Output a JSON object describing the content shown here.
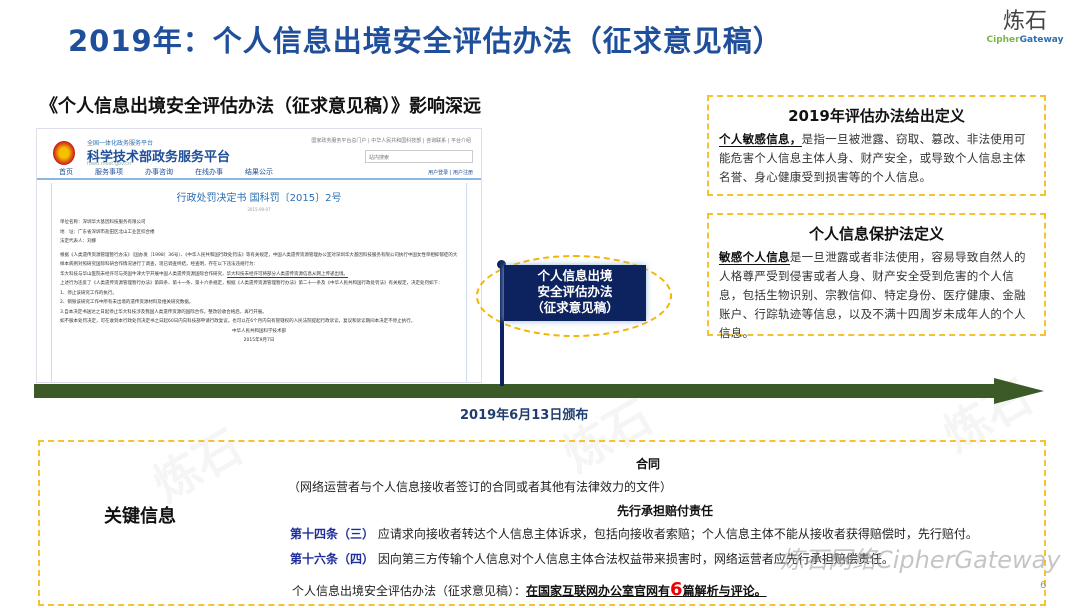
{
  "title": "2019年：个人信息出境安全评估办法（征求意见稿）",
  "logo": {
    "cn": "炼石",
    "en_a": "Cipher",
    "en_b": "Gateway"
  },
  "subtitle": "《个人信息出境安全评估办法（征求意见稿）》影响深远",
  "screenshot": {
    "site_top": "全国一体化政务服务平台",
    "site_name": "科学技术部政务服务平台",
    "site_url": "fuwu.most.gov.cn",
    "top_links": "国家政务服务平台总门户 | 中华人民共和国科技部 | 咨询联系 | 平台介绍",
    "search_placeholder": "站内搜索",
    "nav": [
      "首页",
      "服务事项",
      "办事咨询",
      "在线办事",
      "结果公示"
    ],
    "login": "用户登录 | 用户注册",
    "doc_title": "行政处罚决定书 国科罚〔2015〕2号",
    "doc_date": "2015-09-07",
    "lines": [
      "单位名称：深圳华大基因科技服务有限公司",
      "地　址：广东省深圳市盐田区北山工业区综合楼",
      "法定代表人：刘娜",
      "根据《人类遗传资源管理暂行办法》（国办发〔1998〕36号）、《中华人民共和国行政处罚法》等有关规定，中国人类遗传资源管理办公室对深圳华大基因科技服务有限公司执行中国女性单相抑郁症的大样本病例对照研究国际科研合作情况进行了调查，现已调查终结，经查明，存在以下违法违规行为：",
      "华大科技与华山医院未经许可与英国牛津大学开展中国人类遗传资源国际合作研究，"
    ],
    "highlight": "华大科技未经许可将部分人类遗传资源信息从网上传递出境。",
    "lines2": [
      "上述行为违反了《人类遗传资源管理暂行办法》第四条、第十一条、第十六条规定，根据《人类遗传资源管理暂行办法》第二十一条及《中华人民共和国行政处罚法》有关规定，决定处罚如下：",
      "1、停止该研究工作的执行。",
      "2、销毁该研究工作中所有未出境的遗传资源材料及相关研究数据。",
      "3.自本决定书送达之日起停止华大科技涉及我国人类遗传资源的国际合作，整改验收合格后，再行开展。",
      "如不服本处罚决定，可在收到本行政处罚决定书之日起60日内向科技部申请行政复议，也可以在6个月内向有管辖权的人民法院提起行政诉讼，复议和诉讼期间本决定不停止执行。"
    ],
    "sign": "中华人民共和国科学技术部",
    "sign_date": "2015年9月7日"
  },
  "flag": [
    "个人信息出境",
    "安全评估办法",
    "（征求意见稿）"
  ],
  "timeline_date": "2019年6月13日颁布",
  "box1": {
    "heading": "2019年评估办法给出定义",
    "term": "个人敏感信息，",
    "text": "是指一旦被泄露、窃取、篡改、非法使用可能危害个人信息主体人身、财产安全，或导致个人信息主体名誉、身心健康受到损害等的个人信息。"
  },
  "box2": {
    "heading": "个人信息保护法定义",
    "term": "敏感个人信息",
    "text": "是一旦泄露或者非法使用，容易导致自然人的人格尊严受到侵害或者人身、财产安全受到危害的个人信息，包括生物识别、宗教信仰、特定身份、医疗健康、金融账户、行踪轨迹等信息，以及不满十四周岁未成年人的个人信息。"
  },
  "key": {
    "label": "关键信息",
    "contract": "合同",
    "contract_desc": "（网络运营者与个人信息接收者签订的合同或者其他有法律效力的文件）",
    "liability": "先行承担赔付责任",
    "art14_label": "第十四条（三）",
    "art14_text": "应请求向接收者转达个人信息主体诉求，包括向接收者索赔；个人信息主体不能从接收者获得赔偿时，先行赔付。",
    "art16_label": "第十六条（四）",
    "art16_text": "因向第三方传输个人信息对个人信息主体合法权益带来损害时，网络运营者应先行承担赔偿责任。",
    "note_prefix": "个人信息出境安全评估办法（征求意见稿）：",
    "note_a": "在国家互联网办公室官网有",
    "note_num": "6",
    "note_b": "篇解析与评论。",
    "page": "6"
  },
  "watermark": "炼石网络CipherGateway",
  "colors": {
    "title": "#1f4e9a",
    "flag": "#0d2360",
    "timeline": "#3b5a27",
    "dash": "#f4c430",
    "article": "#1f2f9a",
    "highlight": "#e00000"
  }
}
